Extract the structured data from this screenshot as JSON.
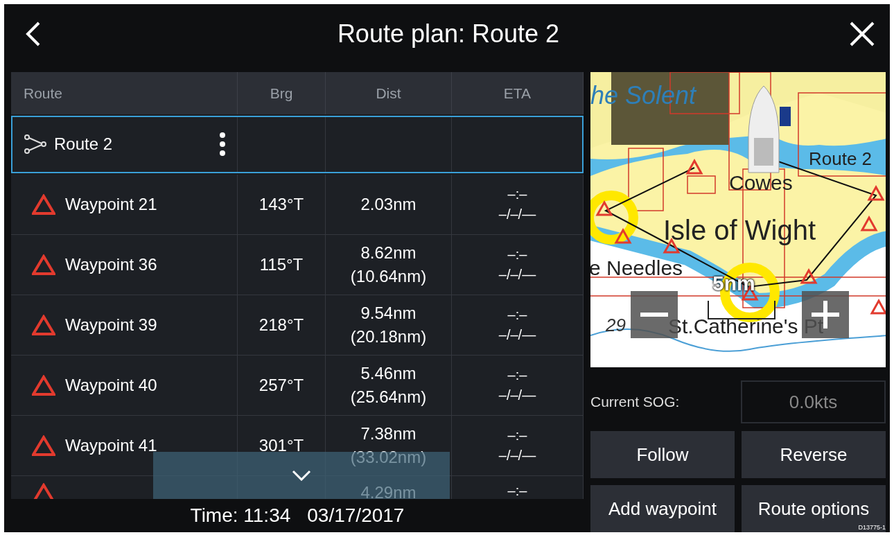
{
  "header": {
    "title": "Route plan: Route 2"
  },
  "table": {
    "columns": [
      "Route",
      "Brg",
      "Dist",
      "ETA"
    ],
    "route_row": {
      "name": "Route 2",
      "selected": true
    },
    "rows": [
      {
        "name": "Waypoint 21",
        "bearing": "143°T",
        "distance": "2.03nm",
        "eta_time": "–:–",
        "eta_date": "–/–/—",
        "selected": false
      },
      {
        "name": "Waypoint 36",
        "bearing": "115°T",
        "distance": "8.62nm",
        "total_distance": "(10.64nm)",
        "eta_time": "–:–",
        "eta_date": "–/–/—",
        "selected": false
      },
      {
        "name": "Waypoint 39",
        "bearing": "218°T",
        "distance": "9.54nm",
        "total_distance": "(20.18nm)",
        "eta_time": "–:–",
        "eta_date": "–/–/—",
        "selected": false
      },
      {
        "name": "Waypoint 40",
        "bearing": "257°T",
        "distance": "5.46nm",
        "total_distance": "(25.64nm)",
        "eta_time": "–:–",
        "eta_date": "–/–/—",
        "selected": false
      },
      {
        "name": "Waypoint 41",
        "bearing": "301°T",
        "distance": "7.38nm",
        "total_distance": "(33.02nm)",
        "eta_time": "–:–",
        "eta_date": "–/–/—",
        "selected": false
      },
      {
        "distance": "4.29nm",
        "eta_time": "–:–",
        "selected": false
      }
    ]
  },
  "status": {
    "time": "Time: 11:34",
    "date": "03/17/2017"
  },
  "map": {
    "labels": [
      {
        "kind": "water",
        "text": "he Solent"
      },
      {
        "kind": "route",
        "text": "Route 2"
      },
      {
        "kind": "place",
        "text": "Cowes"
      },
      {
        "kind": "island",
        "text": "Isle of Wight"
      },
      {
        "kind": "place",
        "text": "e Needles"
      },
      {
        "kind": "scale",
        "text": "5nm"
      },
      {
        "kind": "depth",
        "text": "29"
      },
      {
        "kind": "place",
        "text": "St.Catherine's Pt"
      }
    ]
  },
  "sog": {
    "label": "Current SOG:",
    "value": "0.0kts"
  },
  "buttons": [
    "Follow",
    "Reverse",
    "Add waypoint",
    "Route options"
  ],
  "figure_id": "D13775-1"
}
